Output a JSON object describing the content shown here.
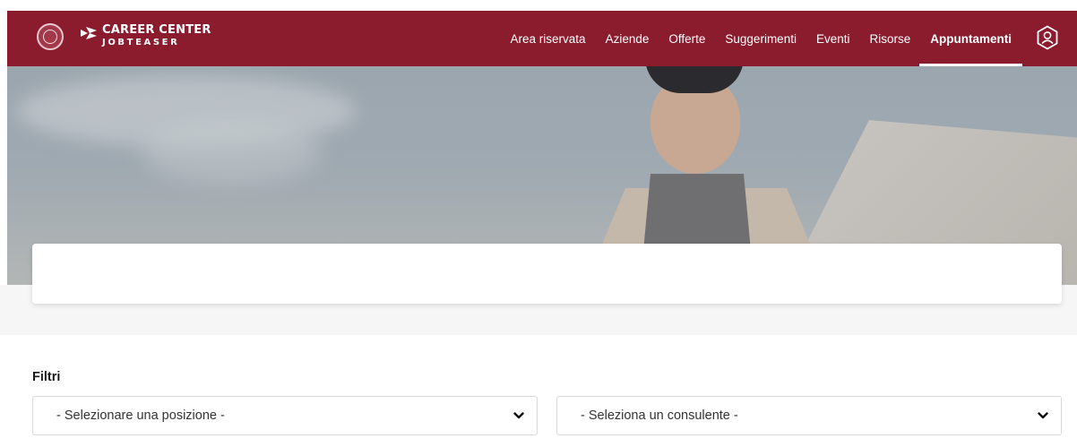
{
  "header": {
    "logo_line1": "CAREER CENTER",
    "logo_line2": "JOBTEASER",
    "brand_color": "#8a1c2e",
    "nav": [
      {
        "label": "Area riservata",
        "active": false
      },
      {
        "label": "Aziende",
        "active": false
      },
      {
        "label": "Offerte",
        "active": false
      },
      {
        "label": "Suggerimenti",
        "active": false
      },
      {
        "label": "Eventi",
        "active": false
      },
      {
        "label": "Risorse",
        "active": false
      },
      {
        "label": "Appuntamenti",
        "active": true
      }
    ],
    "profile_icon": "user-profile-icon"
  },
  "filters": {
    "title": "Filtri",
    "position_select": {
      "selected": "- Selezionare una posizione -"
    },
    "consultant_select": {
      "selected": "- Seleziona un consulente -"
    },
    "chevron_icon": "chevron-down-icon"
  }
}
